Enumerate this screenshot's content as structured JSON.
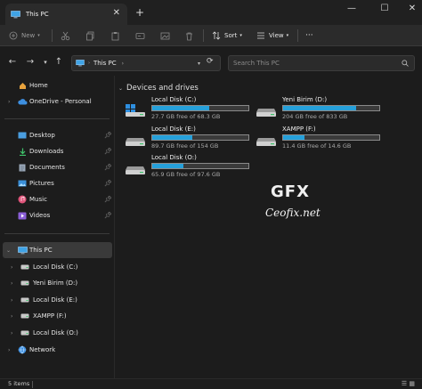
{
  "window": {
    "tab_title": "This PC",
    "tab_close": "✕",
    "new_tab": "+",
    "minimize": "—",
    "maximize": "☐",
    "close": "✕"
  },
  "toolbar": {
    "new_label": "New",
    "sort_label": "Sort",
    "view_label": "View",
    "more_label": "···"
  },
  "address": {
    "location": "This PC",
    "separator": "›",
    "search_placeholder": "Search This PC"
  },
  "sidebar": {
    "items": [
      {
        "label": "Home",
        "icon": "home-icon"
      },
      {
        "label": "OneDrive - Personal",
        "icon": "cloud-icon"
      },
      {
        "label": "Desktop",
        "icon": "desktop-icon"
      },
      {
        "label": "Downloads",
        "icon": "download-icon"
      },
      {
        "label": "Documents",
        "icon": "document-icon"
      },
      {
        "label": "Pictures",
        "icon": "picture-icon"
      },
      {
        "label": "Music",
        "icon": "music-icon"
      },
      {
        "label": "Videos",
        "icon": "video-icon"
      },
      {
        "label": "This PC",
        "icon": "pc-icon"
      },
      {
        "label": "Local Disk (C:)",
        "icon": "drive-icon"
      },
      {
        "label": "Yeni Birim (D:)",
        "icon": "drive-icon"
      },
      {
        "label": "Local Disk (E:)",
        "icon": "drive-icon"
      },
      {
        "label": "XAMPP (F:)",
        "icon": "drive-icon"
      },
      {
        "label": "Local Disk (O:)",
        "icon": "drive-icon"
      },
      {
        "label": "Network",
        "icon": "network-icon"
      }
    ]
  },
  "content": {
    "group_title": "Devices and drives",
    "drives": [
      {
        "name": "Local Disk (C:)",
        "free": "27.7 GB free of 68.3 GB",
        "used_fraction": 0.59
      },
      {
        "name": "Yeni Birim (D:)",
        "free": "204 GB free of 833 GB",
        "used_fraction": 0.76
      },
      {
        "name": "Local Disk (E:)",
        "free": "89.7 GB free of 154 GB",
        "used_fraction": 0.42
      },
      {
        "name": "XAMPP (F:)",
        "free": "11.4 GB free of 14.6 GB",
        "used_fraction": 0.22
      },
      {
        "name": "Local Disk (O:)",
        "free": "65.9 GB free of 97.6 GB",
        "used_fraction": 0.32
      }
    ]
  },
  "watermark": {
    "logo": "GFX",
    "text": "Ceofix.net"
  },
  "status": {
    "items": "5 items"
  },
  "colors": {
    "accent": "#26a0da",
    "background": "#1c1c1c"
  }
}
